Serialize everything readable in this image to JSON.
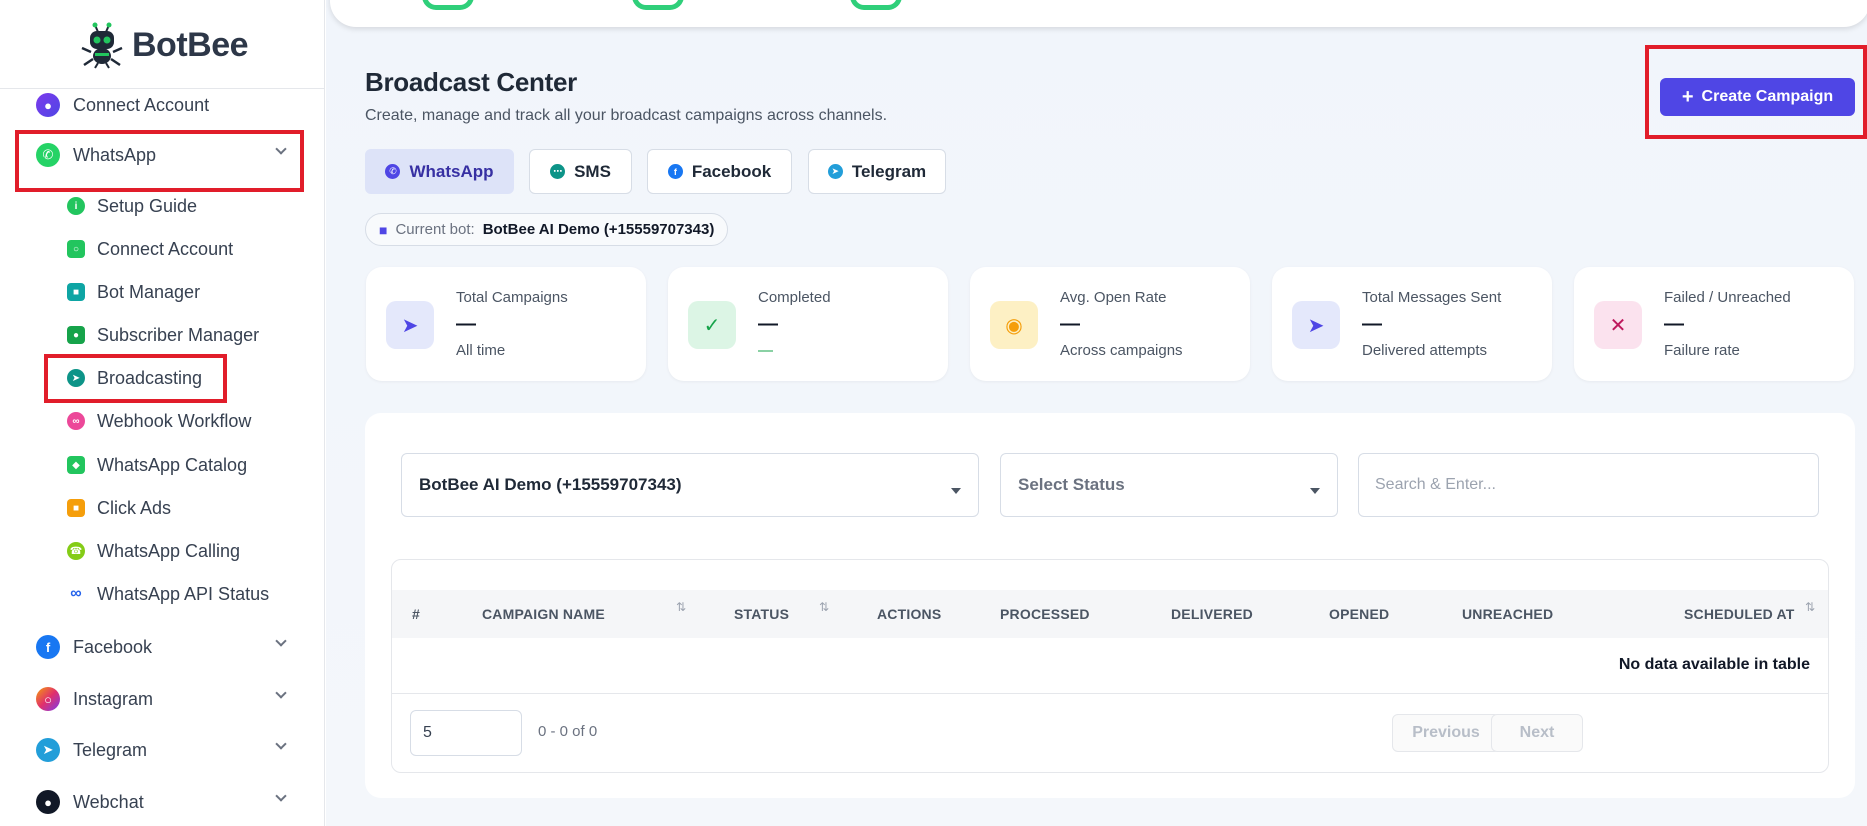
{
  "brand": {
    "name": "BotBee"
  },
  "sidebar": {
    "connect_account": "Connect Account",
    "whatsapp": "WhatsApp",
    "sub_items": [
      {
        "label": "Setup Guide",
        "icon": "info-icon"
      },
      {
        "label": "Connect Account",
        "icon": "link-icon"
      },
      {
        "label": "Bot Manager",
        "icon": "robot-icon"
      },
      {
        "label": "Subscriber Manager",
        "icon": "users-icon"
      },
      {
        "label": "Broadcasting",
        "icon": "megaphone-icon"
      },
      {
        "label": "Webhook Workflow",
        "icon": "webhook-icon"
      },
      {
        "label": "WhatsApp Catalog",
        "icon": "bag-icon"
      },
      {
        "label": "Click Ads",
        "icon": "ads-icon"
      },
      {
        "label": "WhatsApp Calling",
        "icon": "phone-icon"
      },
      {
        "label": "WhatsApp API Status",
        "icon": "meta-icon"
      }
    ],
    "facebook": "Facebook",
    "instagram": "Instagram",
    "telegram": "Telegram",
    "webchat": "Webchat"
  },
  "header": {
    "title": "Broadcast Center",
    "subtitle": "Create, manage and track all your broadcast campaigns across channels.",
    "create_button": "Create Campaign"
  },
  "channels": [
    "WhatsApp",
    "SMS",
    "Facebook",
    "Telegram"
  ],
  "current_bot": {
    "label": "Current bot:",
    "value": "BotBee AI Demo (+15559707343)"
  },
  "stats": [
    {
      "title": "Total Campaigns",
      "value": "—",
      "sub": "All time",
      "color": "#4f46e5"
    },
    {
      "title": "Completed",
      "value": "—",
      "sub": "—",
      "color": "#16a34a"
    },
    {
      "title": "Avg. Open Rate",
      "value": "—",
      "sub": "Across campaigns",
      "color": "#f59e0b"
    },
    {
      "title": "Total Messages Sent",
      "value": "—",
      "sub": "Delivered attempts",
      "color": "#4f46e5"
    },
    {
      "title": "Failed / Unreached",
      "value": "—",
      "sub": "Failure rate",
      "color": "#be185d"
    }
  ],
  "filters": {
    "bot_select": "BotBee AI Demo (+15559707343)",
    "status_select": "Select Status",
    "search_placeholder": "Search & Enter..."
  },
  "table": {
    "columns": [
      "#",
      "CAMPAIGN NAME",
      "STATUS",
      "ACTIONS",
      "PROCESSED",
      "DELIVERED",
      "OPENED",
      "UNREACHED",
      "SCHEDULED AT"
    ],
    "empty": "No data available in table",
    "page_size": "5",
    "page_info": "0 - 0 of 0",
    "prev": "Previous",
    "next": "Next"
  },
  "colors": {
    "accent": "#4f46e5",
    "highlight": "#e11d2a",
    "whatsapp": "#25d366"
  }
}
